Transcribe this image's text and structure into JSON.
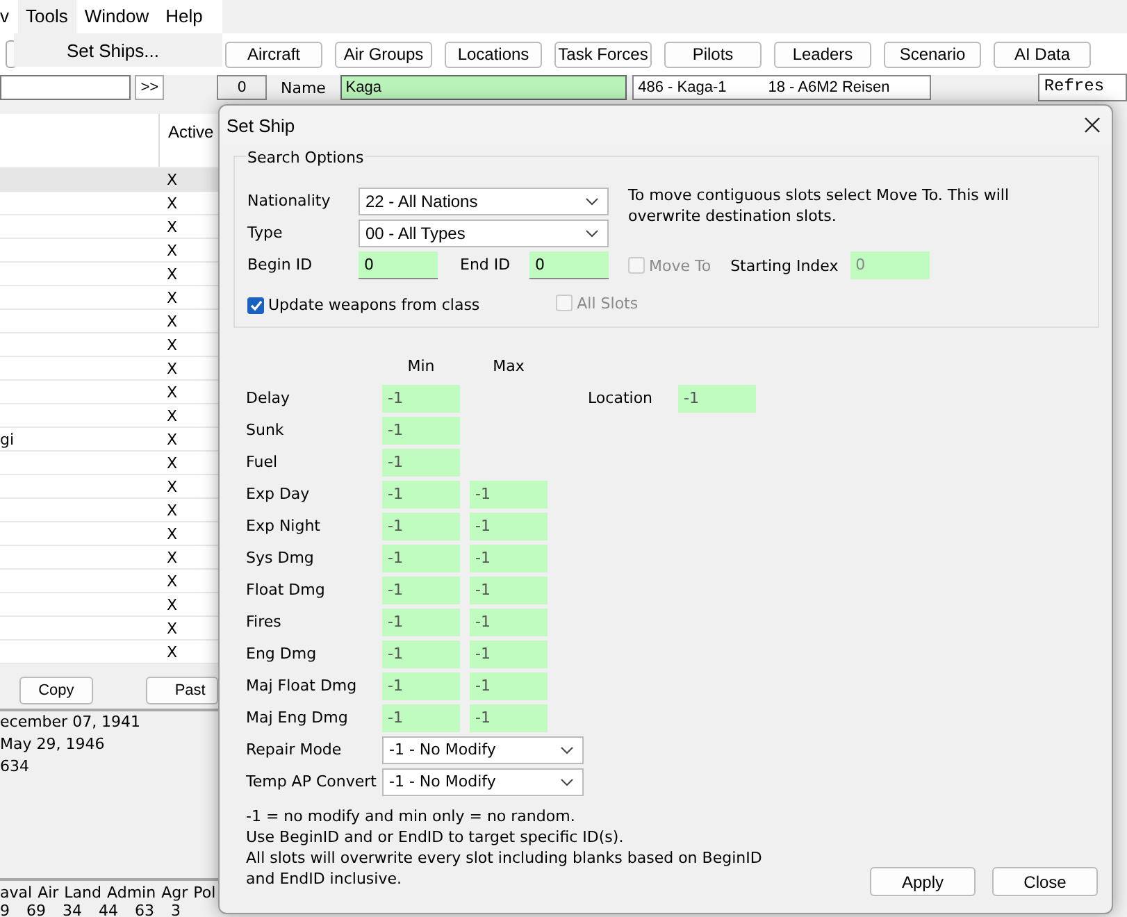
{
  "menu": [
    {
      "label": "v",
      "open": false
    },
    {
      "label": "Tools",
      "open": true
    },
    {
      "label": "Window",
      "open": false
    },
    {
      "label": "Help",
      "open": false
    }
  ],
  "dropdown": {
    "items": [
      "Set Ships..."
    ]
  },
  "toolbar_buttons": [
    "Aircraft",
    "Air Groups",
    "Locations",
    "Task Forces",
    "Pilots",
    "Leaders",
    "Scenario",
    "AI Data"
  ],
  "search": {
    "button": ">>"
  },
  "record": {
    "index": "0",
    "name_label": "Name",
    "name": "Kaga",
    "info": [
      "486 - Kaga-1",
      "18 - A6M2 Reisen"
    ],
    "refresh": "Refres"
  },
  "list": {
    "header": "Active",
    "rows": [
      {
        "active": "X",
        "selected": true
      },
      {
        "active": "X",
        "selected": false
      },
      {
        "active": "X",
        "selected": false
      },
      {
        "active": "X",
        "selected": false
      },
      {
        "active": "X",
        "selected": false
      },
      {
        "active": "X",
        "selected": false
      },
      {
        "active": "X",
        "selected": false
      },
      {
        "active": "X",
        "selected": false
      },
      {
        "active": "X",
        "selected": false
      },
      {
        "active": "X",
        "selected": false
      },
      {
        "active": "X",
        "selected": false
      },
      {
        "text": "gi",
        "active": "X",
        "selected": false
      },
      {
        "active": "X",
        "selected": false
      },
      {
        "active": "X",
        "selected": false
      },
      {
        "active": "X",
        "selected": false
      },
      {
        "active": "X",
        "selected": false
      },
      {
        "active": "X",
        "selected": false
      },
      {
        "active": "X",
        "selected": false
      },
      {
        "active": "X",
        "selected": false
      },
      {
        "active": "X",
        "selected": false
      },
      {
        "active": "X",
        "selected": false
      }
    ]
  },
  "list_buttons": [
    "Copy",
    "Past"
  ],
  "dates": [
    "ecember 07, 1941",
    "May 29, 1946",
    "634"
  ],
  "stats": {
    "headers": [
      "aval",
      "Air",
      "Land",
      "Admin",
      "Agr",
      "Pol"
    ],
    "values": [
      "9",
      "69",
      "34",
      "44",
      "63",
      "3"
    ]
  },
  "dialog": {
    "title": "Set Ship",
    "search_options": {
      "legend": "Search Options",
      "nationality": {
        "label": "Nationality",
        "value": "22 - All Nations"
      },
      "type": {
        "label": "Type",
        "value": "00 - All Types"
      },
      "begin_id": {
        "label": "Begin ID",
        "value": "0"
      },
      "end_id": {
        "label": "End ID",
        "value": "0"
      },
      "note": "To move contiguous slots select Move To. This will overwrite destination slots.",
      "move_to": {
        "label": "Move To",
        "checked": false,
        "disabled": true
      },
      "starting_index": {
        "label": "Starting Index",
        "value": "0",
        "disabled": true
      },
      "update_weapons": {
        "label": "Update weapons from class",
        "checked": true,
        "disabled": false
      },
      "all_slots": {
        "label": "All Slots",
        "checked": false,
        "disabled": true
      }
    },
    "columns": [
      "Min",
      "Max"
    ],
    "fields": [
      {
        "label": "Delay",
        "min": "-1"
      },
      {
        "label": "Sunk",
        "min": "-1"
      },
      {
        "label": "Fuel",
        "min": "-1"
      },
      {
        "label": "Exp Day",
        "min": "-1",
        "max": "-1"
      },
      {
        "label": "Exp Night",
        "min": "-1",
        "max": "-1"
      },
      {
        "label": "Sys Dmg",
        "min": "-1",
        "max": "-1"
      },
      {
        "label": "Float Dmg",
        "min": "-1",
        "max": "-1"
      },
      {
        "label": "Fires",
        "min": "-1",
        "max": "-1"
      },
      {
        "label": "Eng Dmg",
        "min": "-1",
        "max": "-1"
      },
      {
        "label": "Maj Float Dmg",
        "min": "-1",
        "max": "-1"
      },
      {
        "label": "Maj Eng Dmg",
        "min": "-1",
        "max": "-1"
      }
    ],
    "location": {
      "label": "Location",
      "value": "-1"
    },
    "selects": [
      {
        "label": "Repair Mode",
        "value": "-1 - No Modify"
      },
      {
        "label": "Temp AP Convert",
        "value": "-1 - No Modify"
      }
    ],
    "notes": [
      "-1 = no modify and min only = no random.",
      "Use BeginID and or EndID to target specific ID(s).",
      "All slots will overwrite every slot including blanks based on BeginID and EndID inclusive."
    ],
    "buttons": [
      "Apply",
      "Close"
    ]
  }
}
